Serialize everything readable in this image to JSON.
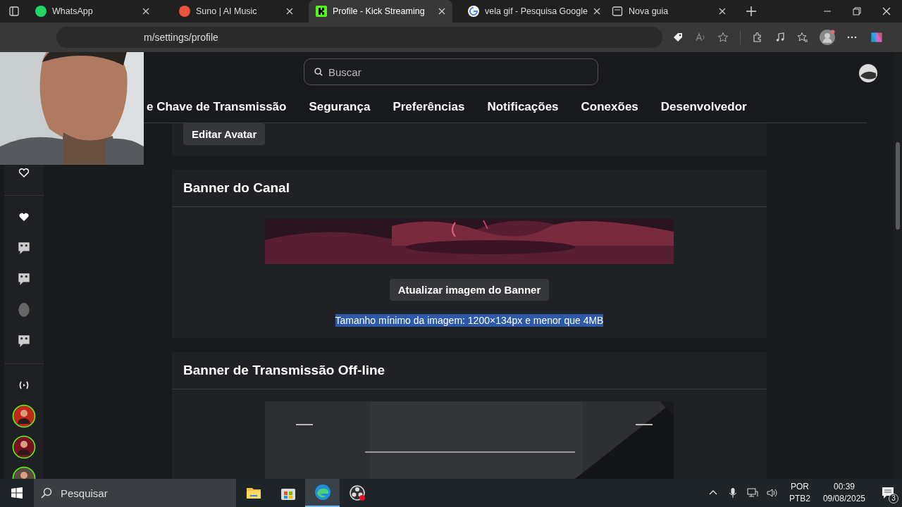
{
  "browser": {
    "tabs": [
      {
        "title": "WhatsApp",
        "kind": "whatsapp",
        "selected": false
      },
      {
        "title": "Suno | AI Music",
        "kind": "suno",
        "selected": false
      },
      {
        "title": "Profile - Kick Streaming",
        "kind": "kick",
        "selected": true
      },
      {
        "title": "vela gif - Pesquisa Google",
        "kind": "google",
        "selected": false
      },
      {
        "title": "Nova guia",
        "kind": "newtab",
        "selected": false
      }
    ],
    "address": "m/settings/profile"
  },
  "header": {
    "search": {
      "placeholder": "Buscar"
    }
  },
  "settings_nav": [
    {
      "label": "e Chave de Transmissão"
    },
    {
      "label": "Segurança"
    },
    {
      "label": "Preferências"
    },
    {
      "label": "Notificações"
    },
    {
      "label": "Conexões"
    },
    {
      "label": "Desenvolvedor"
    }
  ],
  "sidebar": {
    "items": [
      {
        "kind": "heart-outline"
      },
      {
        "kind": "divider"
      },
      {
        "kind": "heart"
      },
      {
        "kind": "emote"
      },
      {
        "kind": "emote"
      },
      {
        "kind": "face"
      },
      {
        "kind": "emote"
      },
      {
        "kind": "divider"
      },
      {
        "kind": "live"
      },
      {
        "kind": "avatar",
        "color": "#c0281c"
      },
      {
        "kind": "avatar",
        "color": "#7a1020"
      },
      {
        "kind": "avatar",
        "color": "#5a4a40"
      }
    ]
  },
  "avatar_section": {
    "button": "Editar Avatar"
  },
  "channel_banner": {
    "title": "Banner do Canal",
    "button": "Atualizar imagem do Banner",
    "hint": "Tamanho mínimo da imagem: 1200×134px e menor que 4MB",
    "hint_highlighted": true
  },
  "offline_banner": {
    "title": "Banner de Transmissão Off-line"
  },
  "taskbar": {
    "search": {
      "placeholder": "Pesquisar"
    },
    "apps": [
      {
        "kind": "explorer",
        "selected": false
      },
      {
        "kind": "store",
        "selected": false
      },
      {
        "kind": "edge",
        "selected": true
      },
      {
        "kind": "obs",
        "selected": false
      }
    ],
    "language": "POR",
    "layout": "PTB2",
    "time": "00:39",
    "date": "09/08/2025",
    "notifications": "3"
  }
}
